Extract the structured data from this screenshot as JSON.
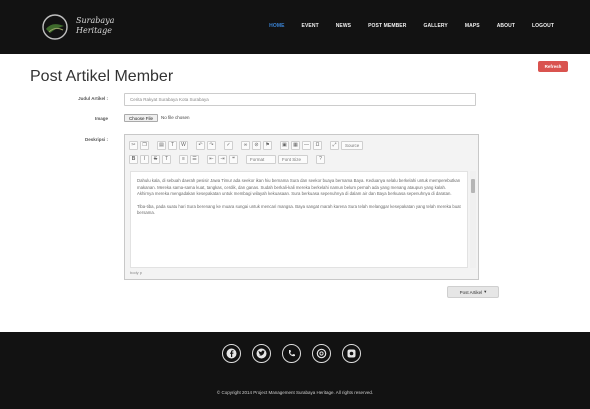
{
  "brand": {
    "line1": "Surabaya",
    "line2": "Heritage"
  },
  "nav": {
    "items": [
      "HOME",
      "EVENT",
      "NEWS",
      "POST MEMBER",
      "GALLERY",
      "MAPS",
      "ABOUT",
      "LOGOUT"
    ],
    "active": "HOME"
  },
  "page": {
    "title": "Post Artikel Member",
    "red_button": "Refresh"
  },
  "form": {
    "judul_label": "Judul Artikel :",
    "judul_value": "Cerita Rakyat Surabaya Kota Surabaya",
    "image_label": "Image",
    "file_button": "Choose File",
    "file_status": "No file chosen",
    "deskripsi_label": "Deskripsi :"
  },
  "editor": {
    "format_select": "Format",
    "size_select": "Font Size",
    "source_label": "Source",
    "paragraphs": [
      "Dahulu kala, di sebuah daerah pesisir Jawa Timur ada seekor ikan hiu bernama Sura dan seekor buaya bernama Baya. Keduanya selalu berkelahi untuk memperebutkan makanan. Mereka sama-sama kuat, tangkas, cerdik, dan ganas. Sudah berkali-kali mereka berkelahi namun belum pernah ada yang menang ataupun yang kalah. Akhirnya mereka mengadakan kesepakatan untuk membagi wilayah kekuasaan. Sura berkuasa sepenuhnya di dalam air dan Baya berkuasa sepenuhnya di daratan.",
      "Tiba-tiba, pada suatu hari Sura berenang ke muara sungai untuk mencari mangsa. Baya sangat marah karena Sura telah melanggar kesepakatan yang telah mereka buat bersama."
    ],
    "status": "body p"
  },
  "actions": {
    "post_button": "Post Artikel"
  },
  "footer": {
    "icons": [
      "facebook-icon",
      "twitter-icon",
      "phone-icon",
      "email-icon",
      "instagram-icon"
    ],
    "copyright": "© Copyright 2014 Project Management Surabaya Heritage. All rights reserved."
  }
}
